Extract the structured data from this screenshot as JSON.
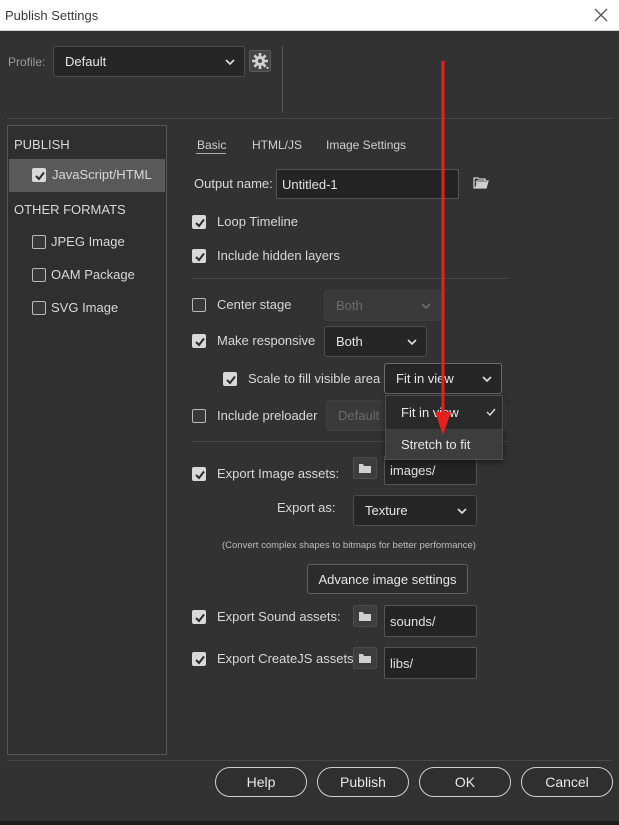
{
  "window": {
    "title": "Publish Settings"
  },
  "profile": {
    "label": "Profile:",
    "value": "Default"
  },
  "left_panel": {
    "publish_header": "PUBLISH",
    "publish_items": [
      {
        "label": "JavaScript/HTML",
        "checked": true
      }
    ],
    "other_header": "OTHER FORMATS",
    "other_items": [
      {
        "label": "JPEG Image",
        "checked": false
      },
      {
        "label": "OAM Package",
        "checked": false
      },
      {
        "label": "SVG Image",
        "checked": false
      }
    ]
  },
  "tabs": [
    "Basic",
    "HTML/JS",
    "Image Settings"
  ],
  "basic": {
    "output_name_label": "Output name:",
    "output_name_value": "Untitled-1",
    "loop_timeline": "Loop Timeline",
    "include_hidden_layers": "Include hidden layers",
    "center_stage": "Center stage",
    "center_stage_value": "Both",
    "make_responsive": "Make responsive",
    "make_responsive_value": "Both",
    "scale_to_fill": "Scale to fill visible area",
    "scale_value": "Fit in view",
    "include_preloader": "Include preloader",
    "preloader_value": "Default",
    "export_image_assets": "Export Image assets:",
    "images_path": "images/",
    "export_as_label": "Export as:",
    "export_as_value": "Texture",
    "convert_note": "(Convert complex shapes to bitmaps for better performance)",
    "advance_image_settings": "Advance image settings",
    "export_sound_assets": "Export Sound assets:",
    "sounds_path": "sounds/",
    "export_createjs_assets": "Export CreateJS assets:",
    "libs_path": "libs/"
  },
  "scale_dropdown": {
    "options": [
      {
        "label": "Fit in view",
        "selected": true
      },
      {
        "label": "Stretch to fit",
        "selected": false
      }
    ]
  },
  "buttons": {
    "help": "Help",
    "publish": "Publish",
    "ok": "OK",
    "cancel": "Cancel"
  },
  "colors": {
    "annotation_arrow": "#e8201a",
    "background": "#323232"
  }
}
